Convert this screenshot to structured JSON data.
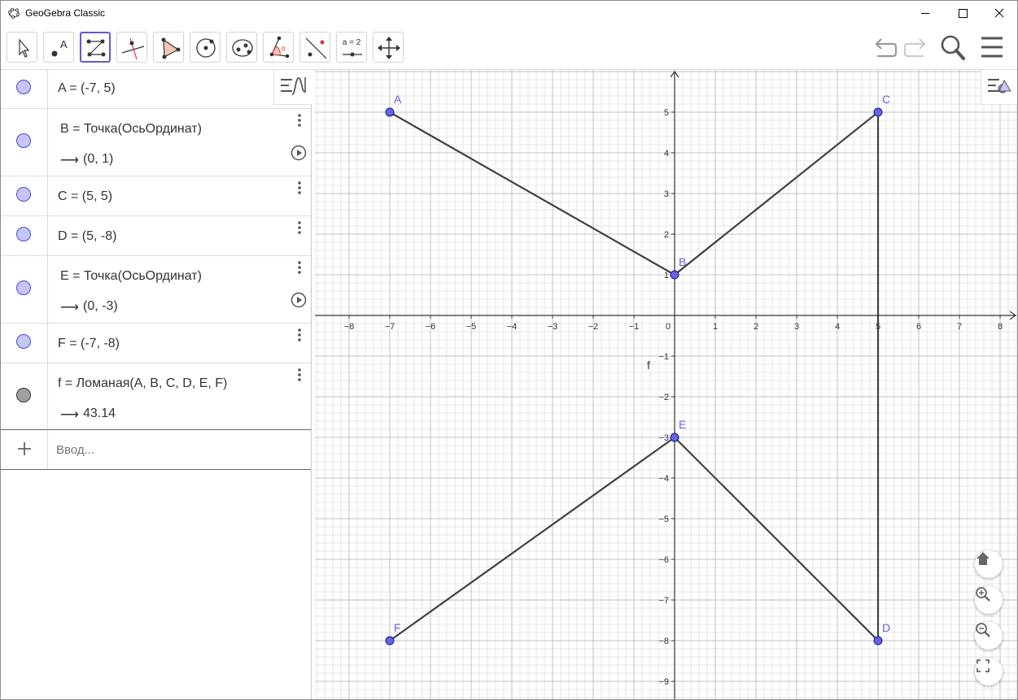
{
  "window": {
    "title": "GeoGebra Classic"
  },
  "toolbar": {
    "tools": [
      {
        "name": "move-tool",
        "icon": "cursor-arrow-icon"
      },
      {
        "name": "point-tool",
        "icon": "point-icon",
        "label": "A"
      },
      {
        "name": "polyline-tool",
        "icon": "polyline-icon",
        "active": true
      },
      {
        "name": "perpendicular-tool",
        "icon": "perpendicular-line-icon"
      },
      {
        "name": "polygon-tool",
        "icon": "polygon-icon"
      },
      {
        "name": "circle-tool",
        "icon": "circle-center-icon"
      },
      {
        "name": "ellipse-tool",
        "icon": "ellipse-icon"
      },
      {
        "name": "angle-tool",
        "icon": "angle-icon"
      },
      {
        "name": "reflect-tool",
        "icon": "reflect-line-icon"
      },
      {
        "name": "slider-tool",
        "icon": "slider-icon",
        "label": "a = 2"
      },
      {
        "name": "move-view-tool",
        "icon": "move-graphics-icon"
      }
    ]
  },
  "algebra": {
    "rows": [
      {
        "expr": "A = (-7, 5)",
        "color": "#c5c5f7"
      },
      {
        "expr": "B = Точка(ОсьОрдинат)",
        "output": "(0, 1)",
        "color": "#c5c5f7",
        "animated": true
      },
      {
        "expr": "C = (5, 5)",
        "color": "#c5c5f7"
      },
      {
        "expr": "D = (5, -8)",
        "color": "#c5c5f7"
      },
      {
        "expr": "E = Точка(ОсьОрдинат)",
        "output": "(0, -3)",
        "color": "#c5c5f7",
        "animated": true
      },
      {
        "expr": "F = (-7, -8)",
        "color": "#c5c5f7"
      },
      {
        "expr": "f = Ломаная(A, B, C, D, E, F)",
        "output": "43.14",
        "color": "#a0a0a0"
      }
    ],
    "arrow": "⟶",
    "input_placeholder": "Ввод..."
  },
  "graph": {
    "xmin": -8,
    "xmax": 8,
    "ymin": -9,
    "ymax": 5,
    "x_ticks": [
      "−8",
      "−7",
      "−6",
      "−5",
      "−4",
      "−3",
      "−2",
      "−1",
      "0",
      "1",
      "2",
      "3",
      "4",
      "5",
      "6",
      "7",
      "8"
    ],
    "y_ticks": [
      "5",
      "4",
      "3",
      "2",
      "1",
      "−1",
      "−2",
      "−3",
      "−4",
      "−5",
      "−6",
      "−7",
      "−8",
      "−9"
    ],
    "points": [
      {
        "label": "A",
        "x": -7,
        "y": 5
      },
      {
        "label": "B",
        "x": 0,
        "y": 1
      },
      {
        "label": "C",
        "x": 5,
        "y": 5
      },
      {
        "label": "D",
        "x": 5,
        "y": -8
      },
      {
        "label": "E",
        "x": 0,
        "y": -3
      },
      {
        "label": "F",
        "x": -7,
        "y": -8
      }
    ],
    "polyline_label": "f",
    "point_color": "#6363e5",
    "line_color": "#404040"
  }
}
